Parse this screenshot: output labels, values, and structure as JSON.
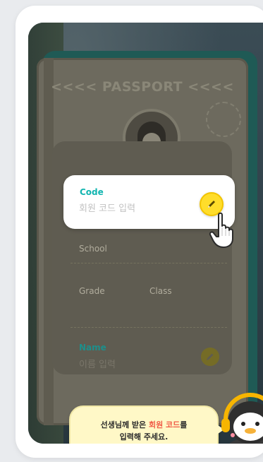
{
  "passport": {
    "title": "<<<< PASSPORT <<<<"
  },
  "form": {
    "code": {
      "label": "Code",
      "placeholder": "회원 코드 입력"
    },
    "school": {
      "label": "School"
    },
    "grade": {
      "label": "Grade"
    },
    "class": {
      "label": "Class"
    },
    "name": {
      "label": "Name",
      "placeholder": "이름 입력"
    }
  },
  "tooltip": {
    "line1_prefix": "선생님께 받은 ",
    "line1_highlight": "회원 코드",
    "line1_suffix": "를",
    "line2": "입력해 주세요."
  },
  "icons": {
    "code_edit": "pencil-icon",
    "name_edit": "pencil-icon",
    "avatar_edit": "pencil-icon",
    "pointer": "hand-pointer-icon"
  },
  "colors": {
    "accent_teal": "#12b5b0",
    "accent_yellow": "#ffdd2b",
    "highlight_red": "#f05a46",
    "bubble_bg": "#fff8c7"
  }
}
